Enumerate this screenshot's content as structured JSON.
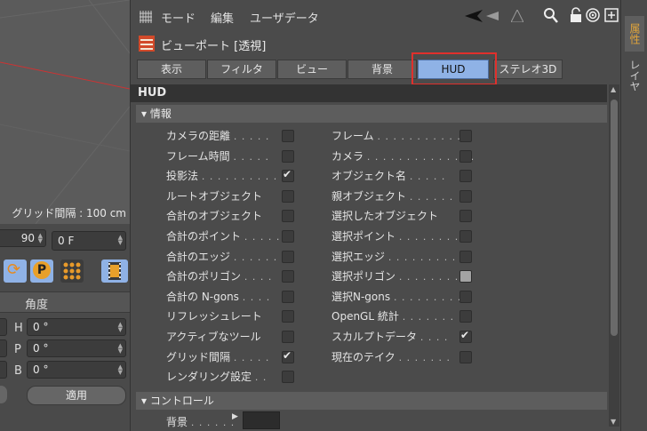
{
  "colors": {
    "accent": "#8fb2e6",
    "highlight": "#e0302c",
    "side_tab_active": "#e3a53a"
  },
  "viewport": {
    "label": "グリッド間隔 : 100 cm"
  },
  "coords": {
    "value_90": "90",
    "frame_field": "0 F",
    "angle_header": "角度",
    "rows": [
      {
        "label": "H",
        "value": "0 °"
      },
      {
        "label": "P",
        "value": "0 °"
      },
      {
        "label": "B",
        "value": "0 °"
      }
    ],
    "apply_button": "適用"
  },
  "menubar": {
    "items": [
      "モード",
      "編集",
      "ユーザデータ"
    ]
  },
  "title": "ビューポート [透視]",
  "tabs": [
    {
      "label": "表示"
    },
    {
      "label": "フィルタ"
    },
    {
      "label": "ビュー"
    },
    {
      "label": "背景"
    },
    {
      "label": "HUD"
    },
    {
      "label": "ステレオ3D"
    }
  ],
  "section": "HUD",
  "info_group": "情報",
  "left_items": [
    {
      "label": "カメラの距離",
      "dots": ". . . . .",
      "checked": false
    },
    {
      "label": "フレーム時間",
      "dots": ". . . . .",
      "checked": false
    },
    {
      "label": "投影法",
      "dots": ". . . . . . . . . . .",
      "checked": true
    },
    {
      "label": "ルートオブジェクト",
      "dots": "",
      "checked": false
    },
    {
      "label": "合計のオブジェクト",
      "dots": "",
      "checked": false
    },
    {
      "label": "合計のポイント",
      "dots": ". . . . .",
      "checked": false
    },
    {
      "label": "合計のエッジ",
      "dots": ". . . . . .",
      "checked": false
    },
    {
      "label": "合計のポリゴン",
      "dots": ". . . .",
      "checked": false
    },
    {
      "label": "合計の N-gons",
      "dots": ". . . .",
      "checked": false
    },
    {
      "label": "リフレッシュレート",
      "dots": "",
      "checked": false
    },
    {
      "label": "アクティブなツール",
      "dots": "",
      "checked": false
    },
    {
      "label": "グリッド間隔",
      "dots": ". . . . .",
      "checked": true
    },
    {
      "label": "レンダリング設定",
      "dots": ". .",
      "checked": false
    }
  ],
  "right_items": [
    {
      "label": "フレーム",
      "dots": ". . . . . . . . . . . .",
      "checked": false
    },
    {
      "label": "カメラ",
      "dots": ". . . . . . . . . . . . . .",
      "checked": false
    },
    {
      "label": "オブジェクト名",
      "dots": ". . . . .",
      "checked": false
    },
    {
      "label": "親オブジェクト",
      "dots": ". . . . . .",
      "checked": false
    },
    {
      "label": "選択したオブジェクト",
      "dots": "",
      "checked": false
    },
    {
      "label": "選択ポイント",
      "dots": ". . . . . . . .",
      "checked": false
    },
    {
      "label": "選択エッジ",
      "dots": ". . . . . . . . .",
      "checked": false
    },
    {
      "label": "選択ポリゴン",
      "dots": ". . . . . . . .",
      "checked": false,
      "light": true
    },
    {
      "label": "選択N-gons",
      "dots": ". . . . . . . . .",
      "checked": false
    },
    {
      "label": "OpenGL 統計",
      "dots": ". . . . . . .",
      "checked": false
    },
    {
      "label": "スカルプトデータ",
      "dots": ". . . .",
      "checked": true
    },
    {
      "label": "現在のテイク",
      "dots": ". . . . . . .",
      "checked": false
    }
  ],
  "control_group": "コントロール",
  "background_label": "背景",
  "background_dots": ". . . . . .",
  "side_tabs": [
    "属性",
    "レイヤ"
  ]
}
